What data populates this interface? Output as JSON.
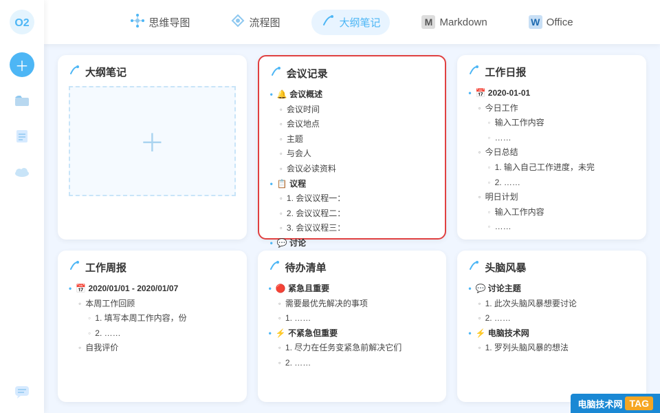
{
  "app": {
    "logo_text": "O2",
    "accent_color": "#4db6f5"
  },
  "sidebar": {
    "icons": [
      {
        "name": "add-icon",
        "symbol": "+",
        "style": "blue-circle"
      },
      {
        "name": "folder-icon",
        "symbol": "📁",
        "style": "normal"
      },
      {
        "name": "document-icon",
        "symbol": "☰",
        "style": "normal"
      },
      {
        "name": "cloud-icon",
        "symbol": "☁",
        "style": "normal"
      },
      {
        "name": "chat-icon",
        "symbol": "💬",
        "style": "normal bottom"
      }
    ]
  },
  "topnav": {
    "items": [
      {
        "id": "mindmap",
        "label": "思维导图",
        "icon": "🗺"
      },
      {
        "id": "flowchart",
        "label": "流程图",
        "icon": "⬡"
      },
      {
        "id": "outline",
        "label": "大纲笔记",
        "icon": "✏",
        "active": true
      },
      {
        "id": "markdown",
        "label": "Markdown",
        "icon": "M"
      },
      {
        "id": "office",
        "label": "Office",
        "icon": "W"
      }
    ]
  },
  "cards": [
    {
      "id": "new-note",
      "title": "大纲笔记",
      "icon": "✏",
      "type": "new",
      "highlighted": false
    },
    {
      "id": "meeting",
      "title": "会议记录",
      "icon": "✏",
      "type": "outline",
      "highlighted": true,
      "items": [
        {
          "level": 1,
          "emoji": "🔔",
          "text": "会议概述"
        },
        {
          "level": 2,
          "text": "会议时间"
        },
        {
          "level": 2,
          "text": "会议地点"
        },
        {
          "level": 2,
          "text": "主题"
        },
        {
          "level": 2,
          "text": "与会人"
        },
        {
          "level": 2,
          "text": "会议必读资料"
        },
        {
          "level": 1,
          "emoji": "📋",
          "text": "议程"
        },
        {
          "level": 2,
          "text": "1. 会议议程一："
        },
        {
          "level": 2,
          "text": "2. 会议议程二："
        },
        {
          "level": 2,
          "text": "3. 会议议程三："
        },
        {
          "level": 1,
          "emoji": "💬",
          "text": "讨论"
        }
      ]
    },
    {
      "id": "work-diary",
      "title": "工作日报",
      "icon": "✏",
      "type": "outline",
      "highlighted": false,
      "items": [
        {
          "level": 1,
          "emoji": "📅",
          "text": "2020-01-01"
        },
        {
          "level": 2,
          "text": "今日工作"
        },
        {
          "level": 3,
          "text": "输入工作内容"
        },
        {
          "level": 3,
          "text": "……"
        },
        {
          "level": 2,
          "text": "今日总结"
        },
        {
          "level": 3,
          "text": "1. 输入自己工作进度，未完"
        },
        {
          "level": 3,
          "text": "2. ……"
        },
        {
          "level": 2,
          "text": "明日计划"
        },
        {
          "level": 3,
          "text": "输入工作内容"
        },
        {
          "level": 3,
          "text": "……"
        }
      ]
    },
    {
      "id": "work-weekly",
      "title": "工作周报",
      "icon": "✏",
      "type": "outline",
      "highlighted": false,
      "items": [
        {
          "level": 1,
          "emoji": "📅",
          "text": "2020/01/01 - 2020/01/07"
        },
        {
          "level": 2,
          "text": "本周工作回顾"
        },
        {
          "level": 3,
          "text": "1. 填写本周工作内容，份"
        },
        {
          "level": 3,
          "text": "2. ……"
        },
        {
          "level": 2,
          "text": "自我评价"
        }
      ]
    },
    {
      "id": "todo",
      "title": "待办清单",
      "icon": "✏",
      "type": "outline",
      "highlighted": false,
      "items": [
        {
          "level": 1,
          "emoji": "🔴",
          "text": "紧急且重要"
        },
        {
          "level": 2,
          "text": "需要最优先解决的事项"
        },
        {
          "level": 2,
          "text": "1. ……"
        },
        {
          "level": 1,
          "emoji": "⚡",
          "text": "不紧急但重要"
        },
        {
          "level": 2,
          "text": "1. 尽力在任务变紧急前解决它们"
        },
        {
          "level": 2,
          "text": "2. ……"
        }
      ]
    },
    {
      "id": "brainstorm",
      "title": "头脑风暴",
      "icon": "✏",
      "type": "outline",
      "highlighted": false,
      "items": [
        {
          "level": 1,
          "emoji": "💬",
          "text": "讨论主题"
        },
        {
          "level": 2,
          "text": "1. 此次头脑风暴想要讨论"
        },
        {
          "level": 2,
          "text": "2. ……"
        },
        {
          "level": 1,
          "emoji": "⚡",
          "text": "电脑技术网"
        },
        {
          "level": 2,
          "text": "1. 罗列头脑风暴的想法"
        }
      ]
    }
  ],
  "watermark": {
    "site": "电脑技术网",
    "tag": "TAG",
    "url": "www.tagxp.com"
  }
}
